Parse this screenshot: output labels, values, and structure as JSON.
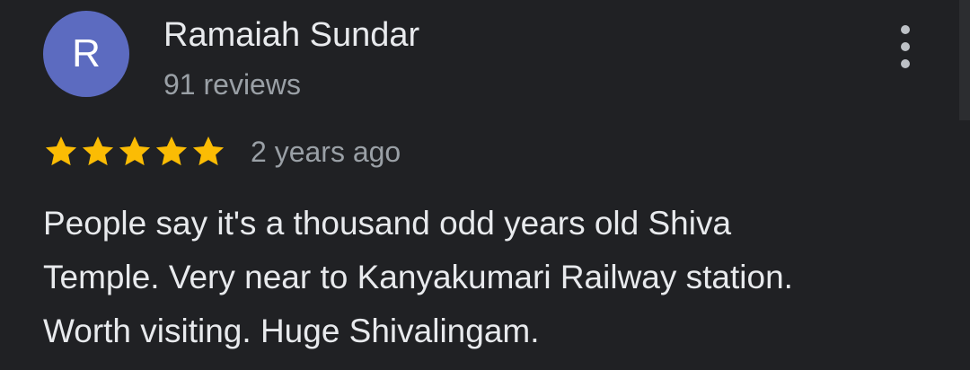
{
  "review": {
    "avatar_letter": "R",
    "avatar_color": "#5c6bc0",
    "reviewer_name": "Ramaiah Sundar",
    "review_count": "91 reviews",
    "rating": 5,
    "rating_max": 5,
    "star_color": "#fbbc04",
    "date": "2 years ago",
    "text": "People say it's a thousand odd years old Shiva Temple. Very near to Kanyakumari Railway station. Worth visiting. Huge Shivalingam.",
    "menu_icon": "more-vert-icon"
  }
}
